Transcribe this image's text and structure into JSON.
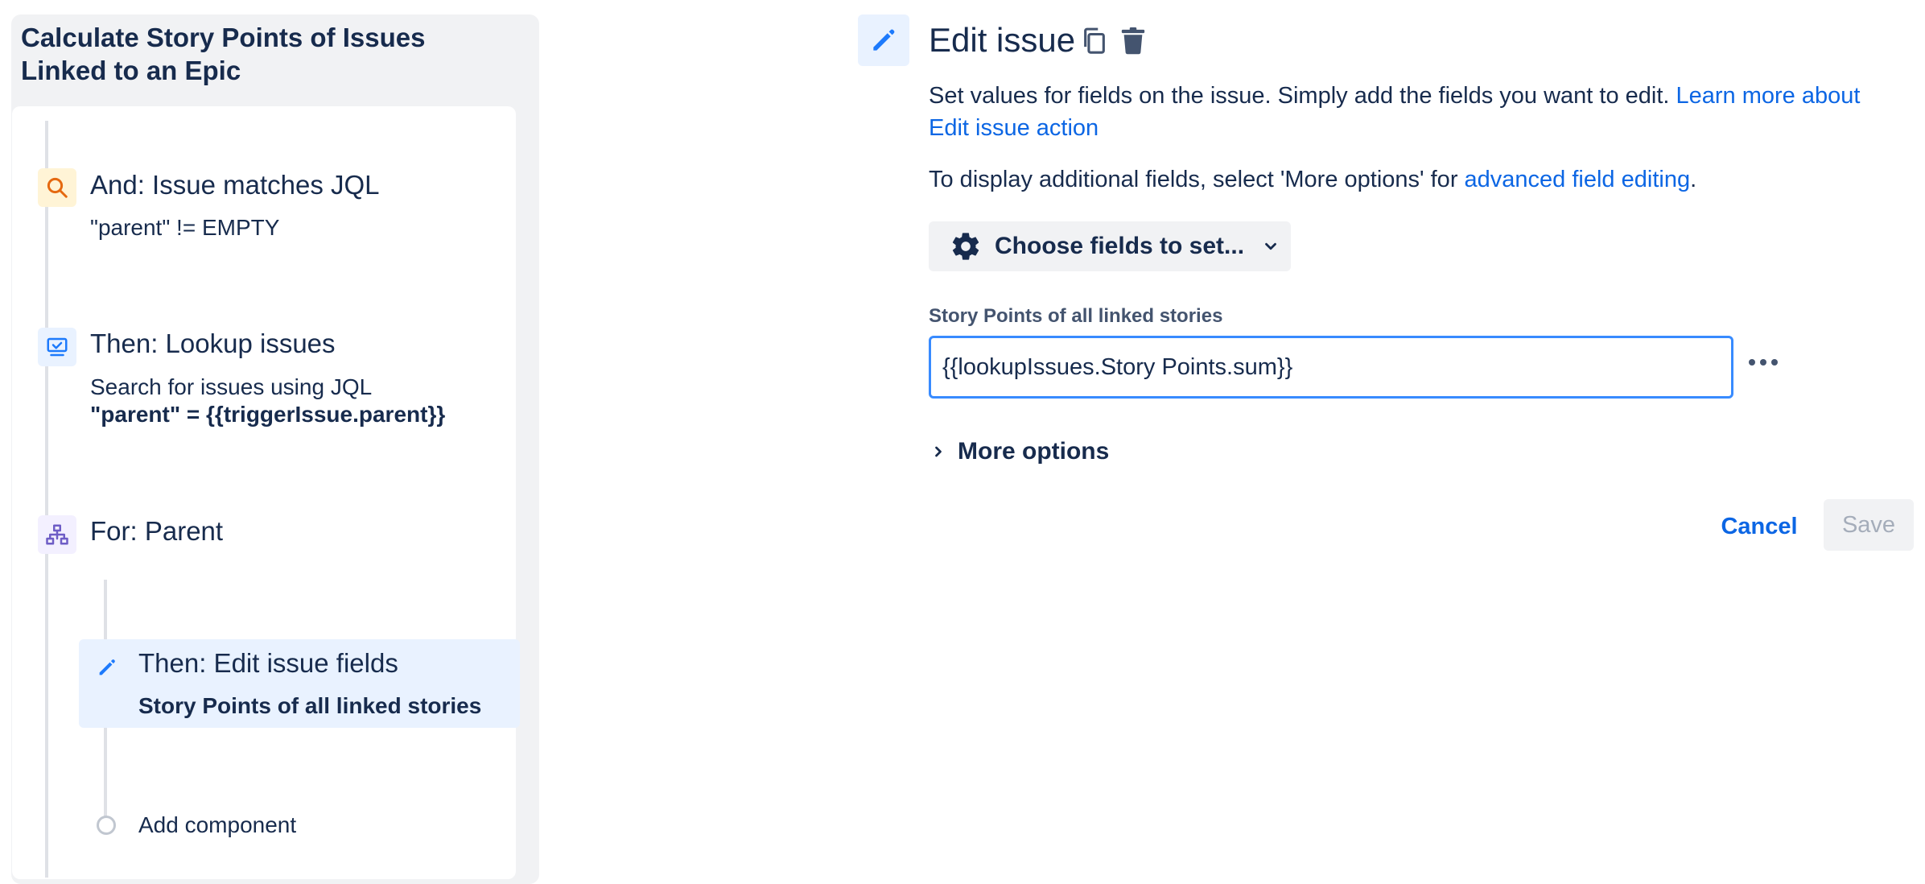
{
  "rule": {
    "title": "Calculate Story Points of Issues Linked to an Epic",
    "steps": [
      {
        "title": "And: Issue matches JQL",
        "description": "\"parent\" != EMPTY",
        "icon": "search-icon"
      },
      {
        "title": "Then: Lookup issues",
        "description": "Search for issues using JQL",
        "query": "\"parent\" = {{triggerIssue.parent}}",
        "icon": "monitor-check-icon"
      },
      {
        "title": "For: Parent",
        "icon": "hierarchy-icon"
      },
      {
        "title": "Then: Edit issue fields",
        "description": "Story Points of all linked stories",
        "icon": "pencil-icon",
        "selected": true
      }
    ],
    "add_component_label": "Add component"
  },
  "edit_panel": {
    "title": "Edit issue",
    "intro_text": "Set values for fields on the issue. Simply add the fields you want to edit. ",
    "intro_link": "Learn more about Edit issue action",
    "advanced_text_before": "To display additional fields, select 'More options' for ",
    "advanced_link": "advanced field editing",
    "advanced_text_after": ".",
    "choose_fields_label": "Choose fields to set...",
    "field_label": "Story Points of all linked stories",
    "field_value": "{{lookupIssues.Story Points.sum}}",
    "more_options_label": "More options",
    "cancel_label": "Cancel",
    "save_label": "Save"
  },
  "colors": {
    "accent": "#0c66e4",
    "selected_bg": "#e9f2ff",
    "condition_icon": "#e56910",
    "branch_icon": "#6e5dc6"
  }
}
